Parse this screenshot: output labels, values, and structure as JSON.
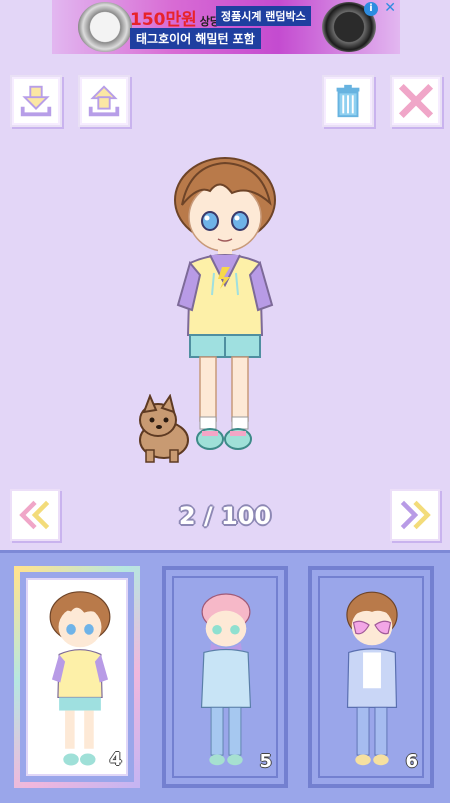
{
  "ad": {
    "price": "150만원",
    "price_suffix": "상당",
    "headline": "정품시계 랜덤박스",
    "subline": "태그호이어 해밀턴 포함",
    "info_icon": "info-icon",
    "close_icon": "close-icon"
  },
  "toolbar": {
    "buttons": [
      {
        "name": "download-icon",
        "color": "#b79ee8"
      },
      {
        "name": "upload-icon",
        "color": "#b79ee8"
      },
      {
        "name": "trash-icon",
        "color": "#67b3e0"
      },
      {
        "name": "close-x-icon",
        "color": "#f0a6c8"
      }
    ]
  },
  "stage": {
    "counter": "2 / 100",
    "prev_icon": "double-chevron-left-icon",
    "next_icon": "double-chevron-right-icon"
  },
  "slots": [
    {
      "number": "4",
      "selected": true
    },
    {
      "number": "5",
      "selected": false
    },
    {
      "number": "6",
      "selected": false
    }
  ],
  "colors": {
    "background": "#e3d6f7",
    "tray": "#9aa6ea",
    "hair": "#b97a4a",
    "hoodie": "#fdf0a8",
    "sleeve": "#b89be6",
    "shorts": "#9fe0e0"
  }
}
